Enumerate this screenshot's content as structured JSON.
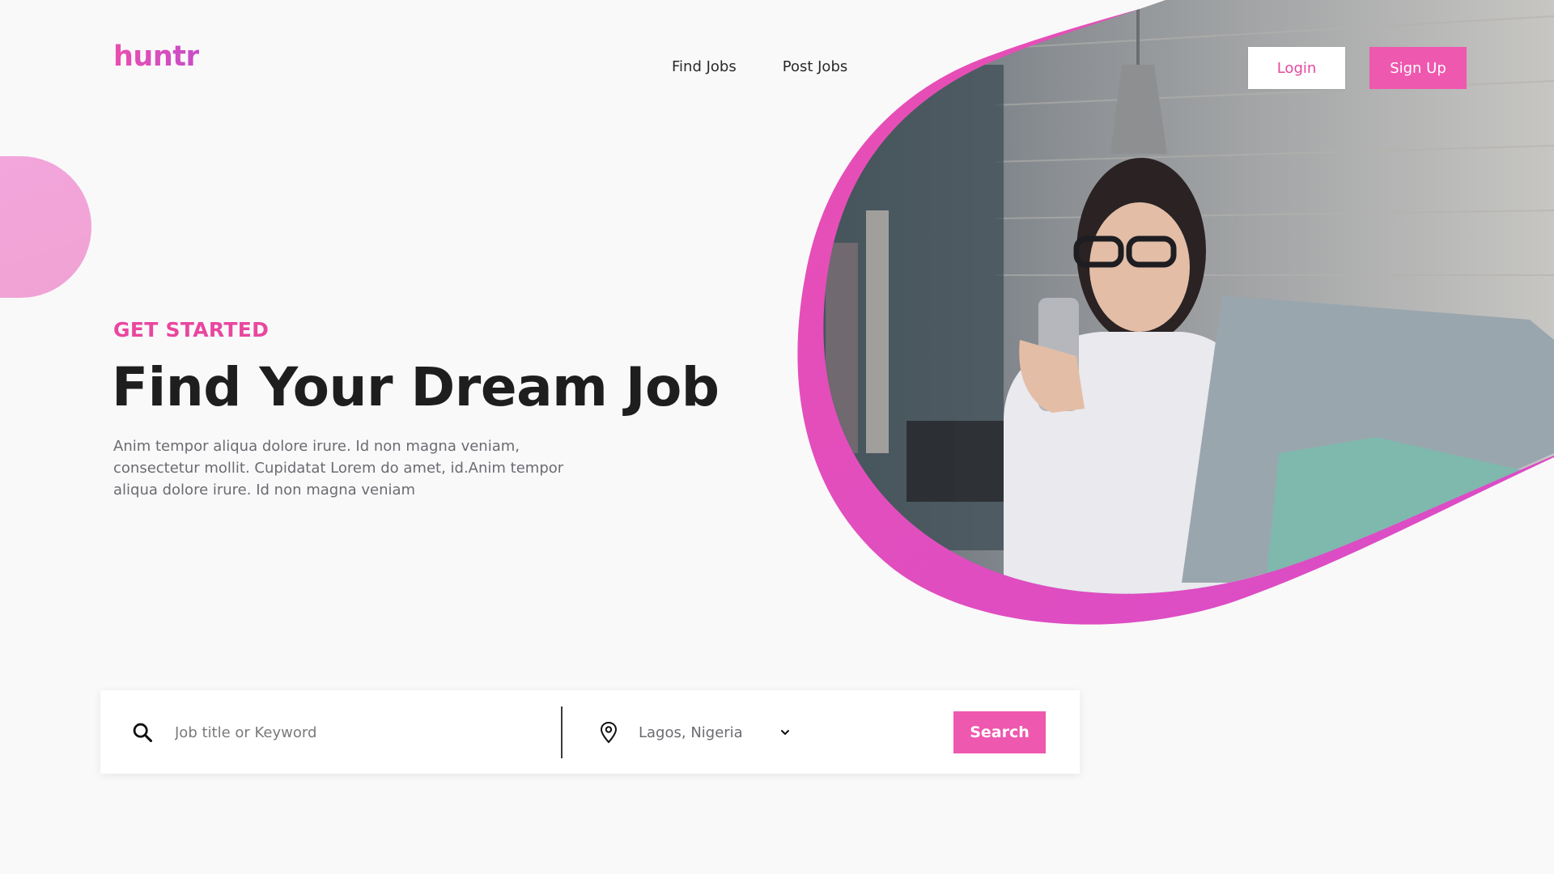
{
  "brand": {
    "logo_text": "huntr",
    "accent": "#ee58ae",
    "text_accent": "#e9479f"
  },
  "nav": {
    "items": [
      {
        "label": "Find Jobs"
      },
      {
        "label": "Post Jobs"
      }
    ]
  },
  "auth": {
    "login_label": "Login",
    "signup_label": "Sign Up"
  },
  "hero": {
    "eyebrow": "GET STARTED",
    "headline": "Find Your Dream Job",
    "lead": "Anim tempor aliqua dolore irure. Id non magna veniam, consectetur mollit. Cupidatat Lorem do amet, id.Anim tempor aliqua dolore irure. Id non magna veniam",
    "image_icon": "woman-with-phone-and-laptop-photo"
  },
  "search": {
    "keyword_placeholder": "Job title or Keyword",
    "keyword_value": "",
    "location_value": "Lagos, Nigeria",
    "button_label": "Search",
    "search_icon": "search-icon",
    "location_icon": "map-pin-icon",
    "dropdown_icon": "chevron-down-icon"
  }
}
